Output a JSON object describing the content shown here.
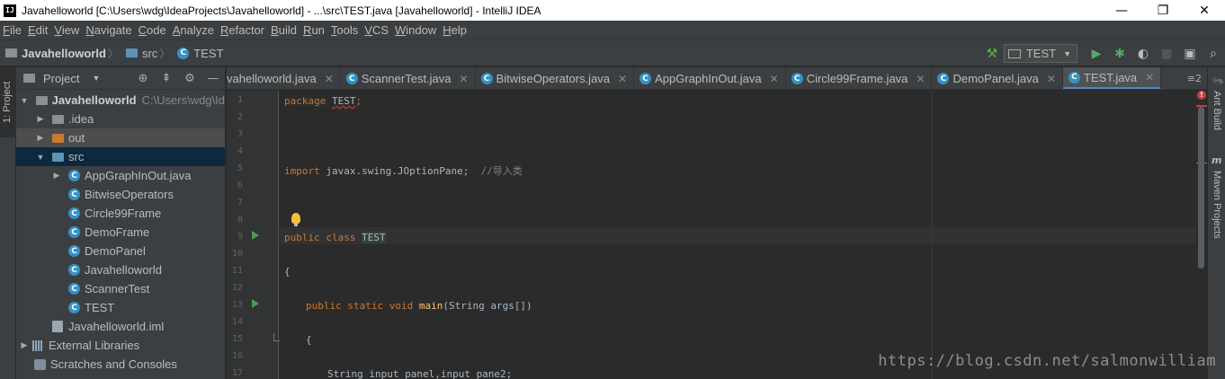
{
  "window": {
    "title": "Javahelloworld [C:\\Users\\wdg\\IdeaProjects\\Javahelloworld] - ...\\src\\TEST.java [Javahelloworld] - IntelliJ IDEA",
    "app_icon": "IJ",
    "controls": {
      "minimize": "—",
      "maximize": "❐",
      "close": "✕"
    }
  },
  "menu": [
    "File",
    "Edit",
    "View",
    "Navigate",
    "Code",
    "Analyze",
    "Refactor",
    "Build",
    "Run",
    "Tools",
    "VCS",
    "Window",
    "Help"
  ],
  "breadcrumb": {
    "project": "Javahelloworld",
    "folder": "src",
    "file": "TEST"
  },
  "run_config": {
    "name": "TEST"
  },
  "project_panel": {
    "title": "Project",
    "tree": {
      "root": {
        "label": "Javahelloworld",
        "path": "C:\\Users\\wdg\\Id"
      },
      "idea": ".idea",
      "out": "out",
      "src": "src",
      "classes": [
        "AppGraphInOut.java",
        "BitwiseOperators",
        "Circle99Frame",
        "DemoFrame",
        "DemoPanel",
        "Javahelloworld",
        "ScannerTest",
        "TEST"
      ],
      "iml": "Javahelloworld.iml",
      "ext_libs": "External Libraries",
      "scratches": "Scratches and Consoles"
    }
  },
  "left_strip": {
    "project_tab": "1: Project"
  },
  "right_strip": {
    "ant": "Ant Build",
    "maven": "Maven Projects"
  },
  "tabs": {
    "items": [
      "vahelloworld.java",
      "ScannerTest.java",
      "BitwiseOperators.java",
      "AppGraphInOut.java",
      "Circle99Frame.java",
      "DemoPanel.java",
      "TEST.java"
    ],
    "overflow": "≡2"
  },
  "editor": {
    "line_numbers": [
      "1",
      "2",
      "3",
      "4",
      "5",
      "6",
      "7",
      "8",
      "9",
      "10",
      "11",
      "12",
      "13",
      "14",
      "15",
      "16",
      "17"
    ],
    "code": {
      "l1_kw": "package",
      "l1_id": "TEST",
      "l1_end": ";",
      "l5_kw": "import",
      "l5_rest": " javax.swing.JOptionPane;  ",
      "l5_comment": "//导入类",
      "l9_kw": "public class",
      "l9_id": "TEST",
      "l11": "{",
      "l13_kw": "public static void",
      "l13_fn": "main",
      "l13_rest": "(String args[])",
      "l15": "{",
      "l17": "String input_panel,input_pane2;"
    },
    "error_badge": "!"
  },
  "watermark": "https://blog.csdn.net/salmonwilliam"
}
